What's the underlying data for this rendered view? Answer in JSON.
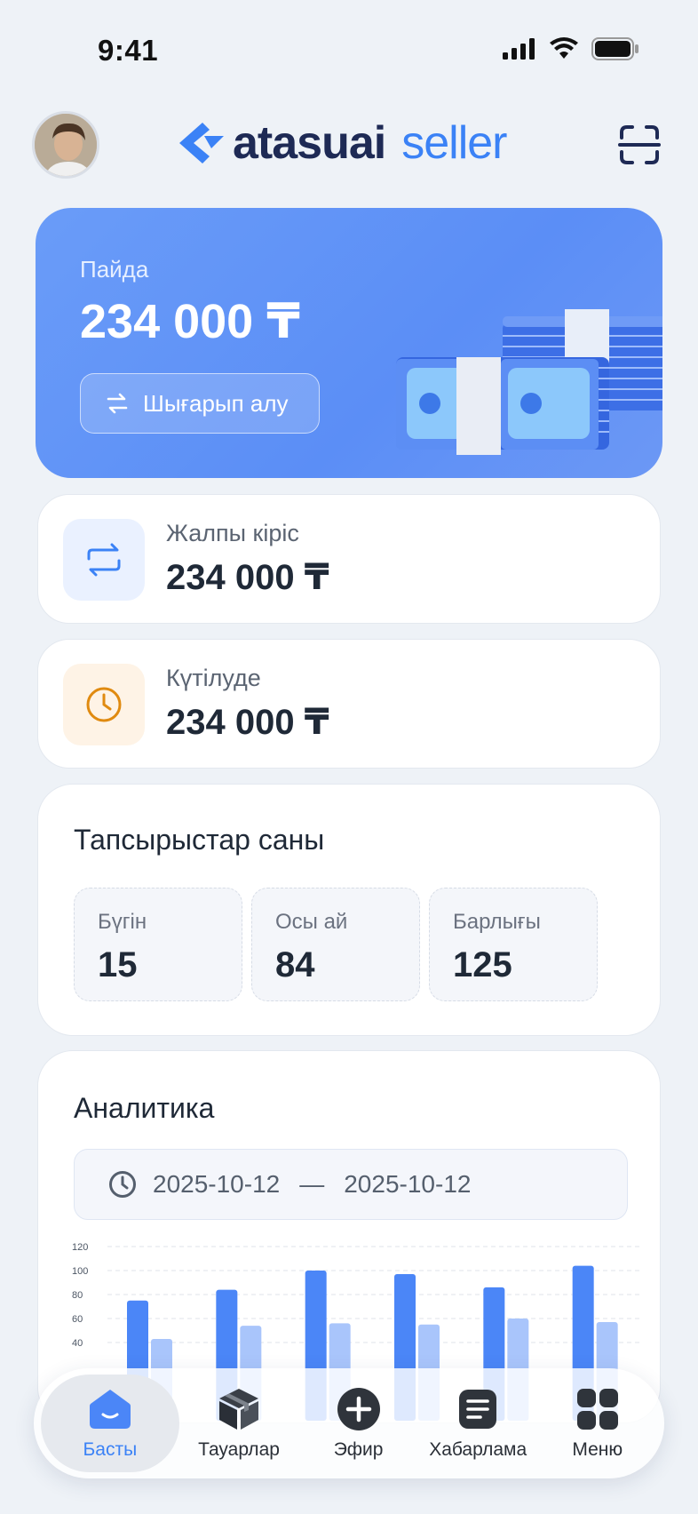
{
  "status_bar": {
    "time": "9:41"
  },
  "header": {
    "logo_main": "atasuai",
    "logo_sub": "seller"
  },
  "profit": {
    "label": "Пайда",
    "amount": "234 000 ₸",
    "withdraw_label": "Шығарып алу"
  },
  "stats": [
    {
      "label": "Жалпы кіріс",
      "value": "234 000 ₸",
      "icon": "transfer-icon",
      "icon_bg": "#eaf1ff",
      "icon_color": "#3b82f6"
    },
    {
      "label": "Күтілуде",
      "value": "234 000 ₸",
      "icon": "clock-icon",
      "icon_bg": "#fef3e6",
      "icon_color": "#e08a10"
    }
  ],
  "orders": {
    "title": "Тапсырыстар саны",
    "items": [
      {
        "label": "Бүгін",
        "value": "15"
      },
      {
        "label": "Осы ай",
        "value": "84"
      },
      {
        "label": "Барлығы",
        "value": "125"
      }
    ]
  },
  "analytics": {
    "title": "Аналитика",
    "date_from": "2025-10-12",
    "separator": "—",
    "date_to": "2025-10-12"
  },
  "chart_data": {
    "type": "bar",
    "y_ticks": [
      "120",
      "100",
      "80",
      "60",
      "40"
    ],
    "ylim": [
      0,
      120
    ],
    "series": [
      {
        "values": [
          75,
          84,
          100,
          97,
          86,
          104
        ],
        "color": "#4b86f7"
      },
      {
        "values": [
          43,
          54,
          56,
          55,
          60,
          57
        ],
        "color": "#a9c5fb"
      }
    ]
  },
  "nav": {
    "items": [
      {
        "label": "Басты",
        "icon": "home-icon",
        "active": true
      },
      {
        "label": "Тауарлар",
        "icon": "box-icon",
        "active": false
      },
      {
        "label": "Эфир",
        "icon": "plus-circle-icon",
        "active": false
      },
      {
        "label": "Хабарлама",
        "icon": "message-icon",
        "active": false
      },
      {
        "label": "Меню",
        "icon": "menu-grid-icon",
        "active": false
      }
    ]
  },
  "colors": {
    "accent": "#3b82f6",
    "brand_dark": "#1e2a55",
    "background": "#eef2f7"
  }
}
